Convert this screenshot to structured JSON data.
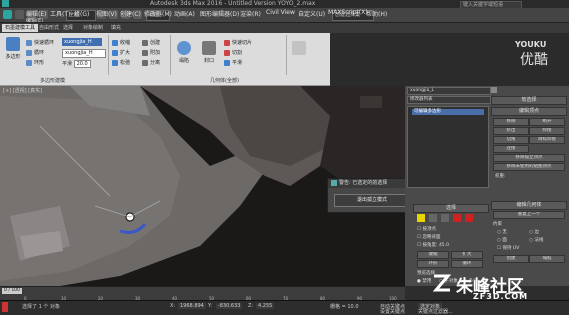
{
  "title_bar": {
    "title": "Autodesk 3ds Max 2016 - Untitled Version     YOYO_2.max",
    "search_placeholder": "键入关键字或短语"
  },
  "menu": {
    "items": [
      "编辑(E)",
      "工具(T)",
      "组(G)",
      "视图(V)",
      "创建(C)",
      "修改器(M)",
      "动画(A)",
      "图形编辑器(D)",
      "渲染(R)",
      "Civil View",
      "自定义(U)",
      "MAXScript(X)",
      "帮助(H)"
    ],
    "selection_dropdown": "全部",
    "view_dropdown": "视图",
    "workspace_dropdown": "创建选择集"
  },
  "ribbon": {
    "tabs": [
      "石墨建模工具",
      "自由形式",
      "选择",
      "对象绘制",
      "填充"
    ],
    "active_tab": "石墨建模工具",
    "polygon_modeling_group": "多边形建模",
    "modify_selection_group": "修改选择",
    "edit_group": "编辑",
    "geometry_group": "几何体(全部)",
    "buttons": {
      "polymodel": "多边形",
      "swift_loop": "快速循环",
      "loop": "循环",
      "ring": "环形",
      "shrink": "收缩",
      "grow": "扩大",
      "relax": "松弛",
      "create": "创建",
      "attach": "附加",
      "detach": "分离",
      "collapse": "塌陷",
      "cap": "封口",
      "quickslice": "快速切片",
      "cut": "切割",
      "smooth": "平滑",
      "smooth_value": "20.0",
      "modifier_name": "xuongjia_H"
    }
  },
  "viewport": {
    "label": "[+] [透视] [真实]"
  },
  "dialog": {
    "title": "警告: 已选定的前选择",
    "button": "退出孤立模式"
  },
  "command_panel": {
    "object_name": "xuongjia_L",
    "modifier_list_label": "修改器列表",
    "stack_item": "可编辑多边形",
    "rollout_selection": "软选择",
    "rollout_edit_vertices": "编辑顶点",
    "rollout_edit_geometry": "编辑几何体",
    "btn_remove": "移除",
    "btn_break": "断开",
    "btn_extrude": "挤出",
    "btn_weld": "焊接",
    "btn_chamfer": "切角",
    "btn_target_weld": "目标焊接",
    "btn_connect": "连接",
    "btn_remove_iso": "移除孤立顶点",
    "btn_remove_unused": "移除未使用的贴图顶点",
    "weight_label": "权重:",
    "btn_repeat": "重复上一个",
    "selection_title": "选择",
    "by_vertex": "按顶点",
    "ignore_backface": "忽略背面",
    "by_angle": "按角度:",
    "angle_value": "45.0",
    "shrink_btn": "收缩",
    "grow_btn": "扩大",
    "ring_btn": "环形",
    "loop_btn": "循环",
    "preview_label": "预览选择",
    "preview_off": "禁用",
    "preview_obj": "子对象",
    "preview_multi": "多个",
    "constraints_label": "约束",
    "c_none": "无",
    "c_edge": "边",
    "c_face": "面",
    "c_normal": "法线",
    "preserve_uv": "保持 UV",
    "create_btn": "创建",
    "collapse_btn": "塌陷"
  },
  "timeline": {
    "frame": "0 / 100",
    "ticks": [
      "0",
      "10",
      "20",
      "30",
      "40",
      "50",
      "60",
      "70",
      "80",
      "90",
      "100"
    ]
  },
  "status_bar": {
    "selection": "选择了 1 个 对象",
    "x_label": "X:",
    "x_value": "1968.894",
    "y_label": "Y:",
    "y_value": "-830.633",
    "z_label": "Z:",
    "z_value": "4.255",
    "grid": "栅格 = 10.0",
    "autokey": "自动关键点",
    "selected_dropdown": "选定对象",
    "set_key": "设置关键点",
    "key_filters": "关键点过滤器..."
  },
  "watermarks": {
    "youku": "YOUKU",
    "youku_cn": "优酷",
    "zf3d": "朱峰社区",
    "zf3d_url": "ZF3D.COM"
  }
}
